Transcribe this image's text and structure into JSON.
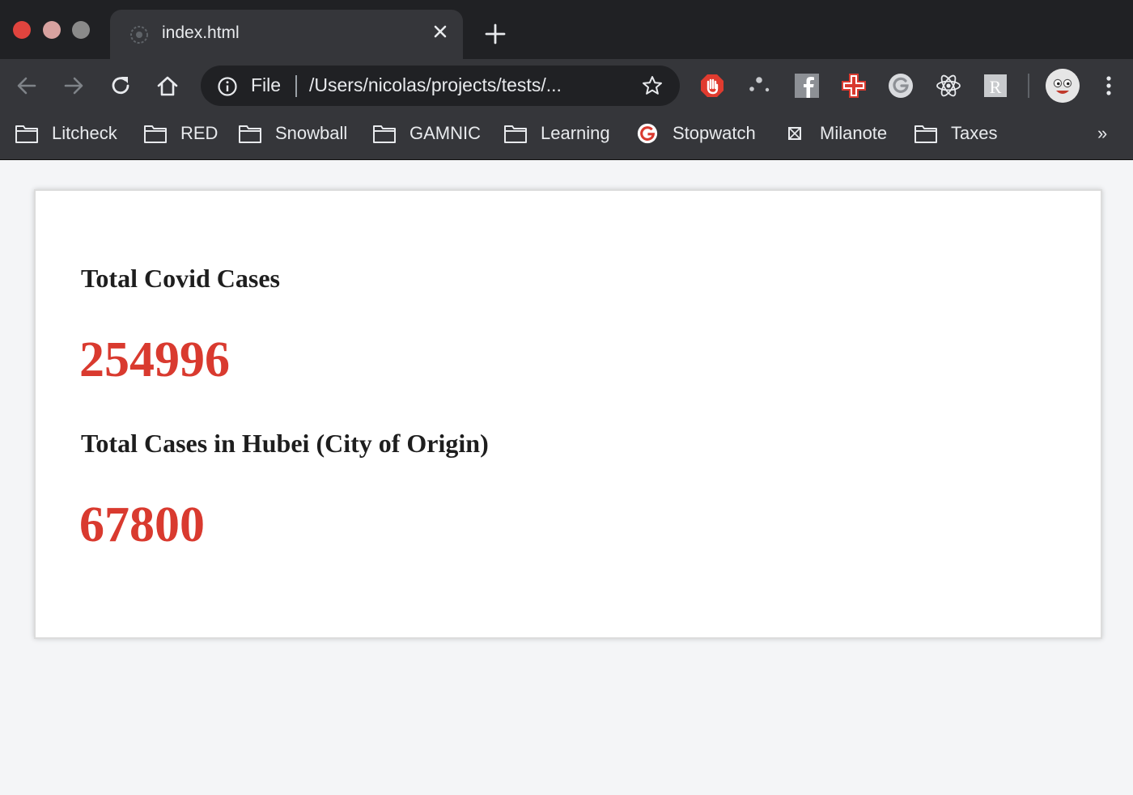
{
  "window": {
    "tab": {
      "title": "index.html"
    }
  },
  "toolbar": {
    "omnibox": {
      "scheme": "File",
      "url": "/Users/nicolas/projects/tests/..."
    },
    "extensions": [
      "adblock-hand-icon",
      "dots-extension-icon",
      "facebook-icon",
      "medical-cross-icon",
      "grammarly-icon",
      "react-devtools-icon",
      "r-extension-icon"
    ]
  },
  "bookmarks": {
    "items": [
      {
        "label": "Litcheck",
        "icon": "folder-icon"
      },
      {
        "label": "RED",
        "icon": "folder-icon"
      },
      {
        "label": "Snowball",
        "icon": "folder-icon"
      },
      {
        "label": "GAMNIC",
        "icon": "folder-icon"
      },
      {
        "label": "Learning",
        "icon": "folder-icon"
      },
      {
        "label": "Stopwatch",
        "icon": "google-icon"
      },
      {
        "label": "Milanote",
        "icon": "milanote-icon"
      },
      {
        "label": "Taxes",
        "icon": "folder-icon"
      }
    ],
    "overflow": "»"
  },
  "page": {
    "stats": [
      {
        "title": "Total Covid Cases",
        "value": "254996"
      },
      {
        "title": "Total Cases in Hubei (City of Origin)",
        "value": "67800"
      }
    ],
    "value_color": "#d93a2f"
  }
}
